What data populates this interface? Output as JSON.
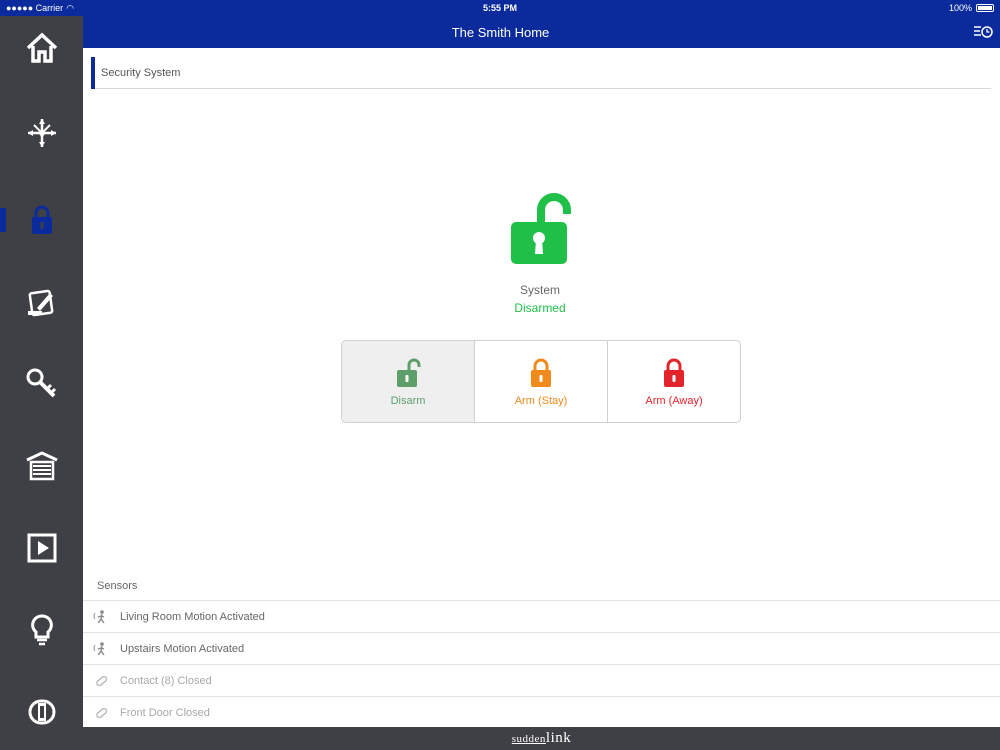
{
  "status_bar": {
    "carrier": "●●●●● Carrier",
    "time": "5:55 PM",
    "battery": "100%"
  },
  "header": {
    "title": "The Smith Home",
    "menu_icon": "list-clock-icon"
  },
  "sidebar": {
    "items": [
      {
        "icon": "home-icon"
      },
      {
        "icon": "network-icon"
      },
      {
        "icon": "lock-icon",
        "active": true
      },
      {
        "icon": "tablet-pen-icon"
      },
      {
        "icon": "key-icon"
      },
      {
        "icon": "garage-icon"
      },
      {
        "icon": "play-icon"
      },
      {
        "icon": "lightbulb-icon"
      },
      {
        "icon": "thermostat-icon"
      }
    ]
  },
  "section": {
    "title": "Security System"
  },
  "system_status": {
    "label": "System",
    "state": "Disarmed",
    "icon": "unlocked-padlock-icon",
    "state_color": "#1fbf48"
  },
  "arm_buttons": [
    {
      "label": "Disarm",
      "icon": "unlocked-padlock-icon",
      "color": "#5e9e6a",
      "selected": true
    },
    {
      "label": "Arm (Stay)",
      "icon": "padlock-icon",
      "color": "#f08a1c",
      "selected": false
    },
    {
      "label": "Arm (Away)",
      "icon": "padlock-icon",
      "color": "#e3242b",
      "selected": false
    }
  ],
  "sensors": {
    "header": "Sensors",
    "items": [
      {
        "label": "Living Room Motion Activated",
        "icon": "motion-icon",
        "active": true
      },
      {
        "label": "Upstairs Motion Activated",
        "icon": "motion-icon",
        "active": true
      },
      {
        "label": "Contact (8) Closed",
        "icon": "contact-icon",
        "active": false
      },
      {
        "label": "Front Door Closed",
        "icon": "contact-icon",
        "active": false
      }
    ]
  },
  "footer": {
    "brand_prefix": "sudden",
    "brand_suffix": "link"
  },
  "colors": {
    "brand_blue": "#0b2b9c",
    "sidebar_bg": "#3f4045"
  }
}
